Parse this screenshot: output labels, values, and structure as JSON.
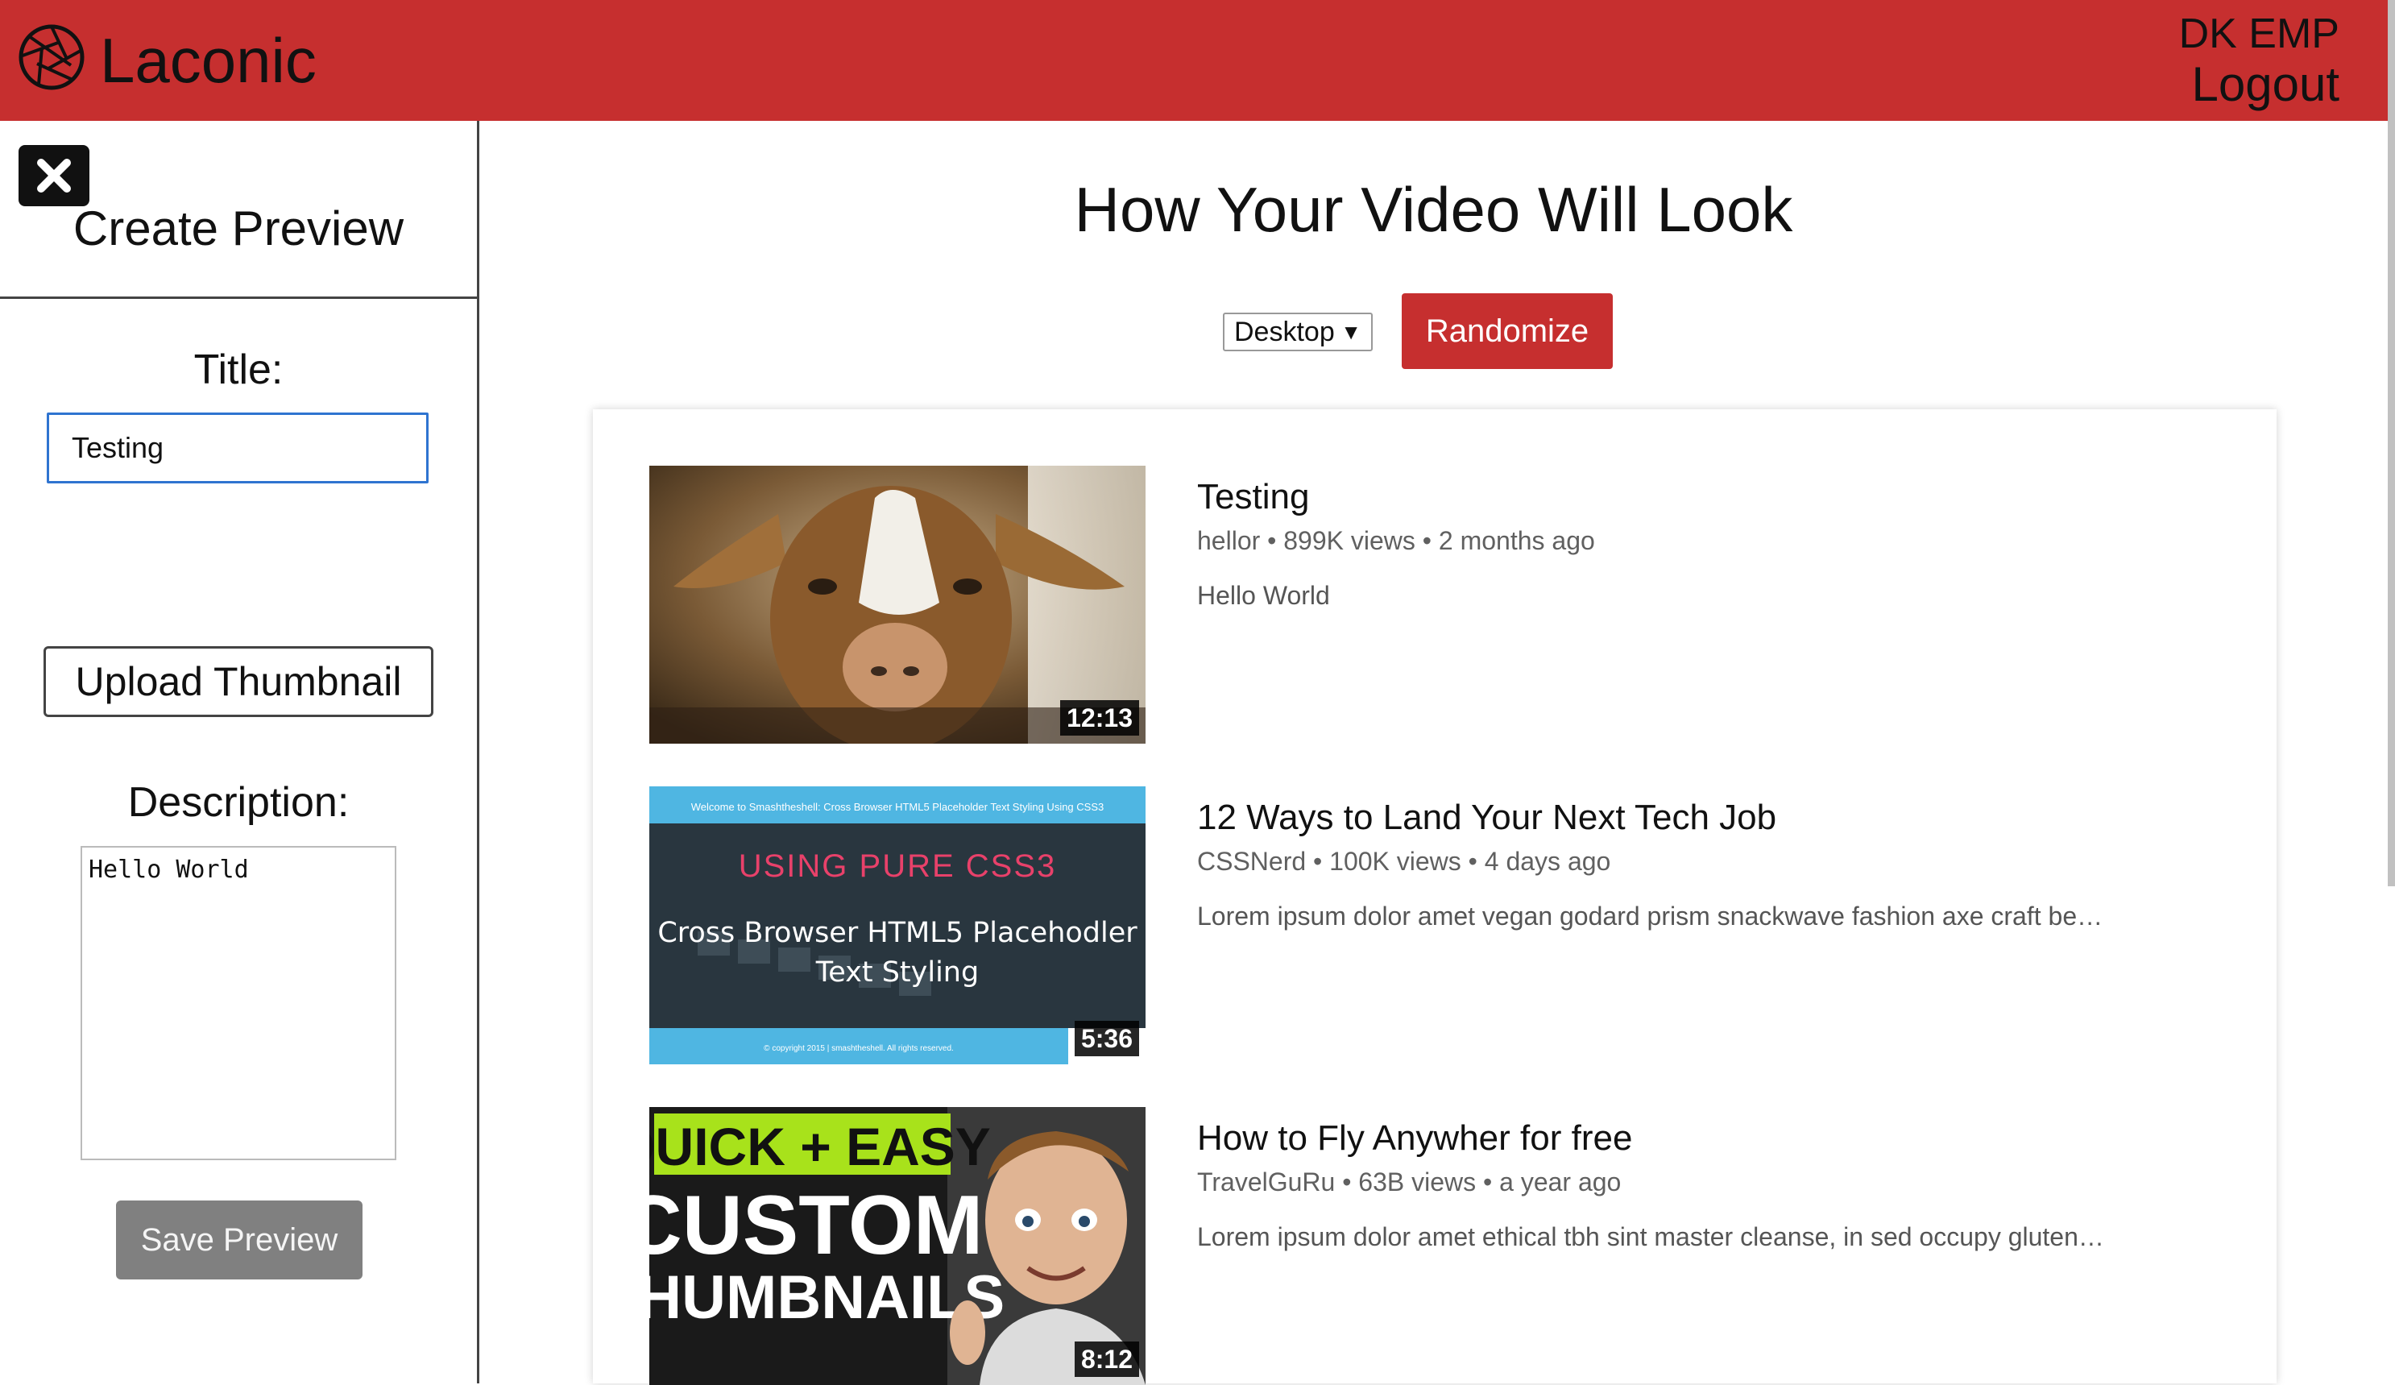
{
  "header": {
    "brand": "Laconic",
    "user": "DK EMP",
    "logout": "Logout"
  },
  "sidebar": {
    "title": "Create Preview",
    "title_label": "Title:",
    "title_value": "Testing",
    "upload_label": "Upload Thumbnail",
    "description_label": "Description:",
    "description_value": "Hello World",
    "save_label": "Save Preview"
  },
  "main": {
    "heading": "How Your Video Will Look",
    "device_selected": "Desktop",
    "randomize_label": "Randomize"
  },
  "videos": [
    {
      "title": "Testing",
      "meta": "hellor • 899K views • 2 months ago",
      "description": "Hello World",
      "duration": "12:13"
    },
    {
      "title": "12 Ways to Land Your Next Tech Job",
      "meta": "CSSNerd • 100K views • 4 days ago",
      "description": "Lorem ipsum dolor amet vegan godard prism snackwave fashion axe craft be…",
      "duration": "5:36",
      "thumb_text": {
        "banner": "Welcome to Smashtheshell: Cross Browser HTML5 Placeholder Text Styling Using CSS3",
        "headline": "USING PURE CSS3",
        "subhead_line1": "Cross Browser HTML5 Placehodler",
        "subhead_line2": "Text Styling",
        "footer": "© copyright 2015 | smashtheshell. All rights reserved."
      }
    },
    {
      "title": "How to Fly Anywher for free",
      "meta": "TravelGuRu • 63B views • a year ago",
      "description": "Lorem ipsum dolor amet ethical tbh sint master cleanse, in sed occupy gluten…",
      "duration": "8:12",
      "thumb_text": {
        "line1": "QUICK + EASY",
        "line2": "CUSTOM",
        "line3": "THUMBNAILS"
      }
    }
  ],
  "colors": {
    "brand_red": "#c62f2f",
    "save_gray": "#808080",
    "input_focus": "#2f74d0"
  }
}
